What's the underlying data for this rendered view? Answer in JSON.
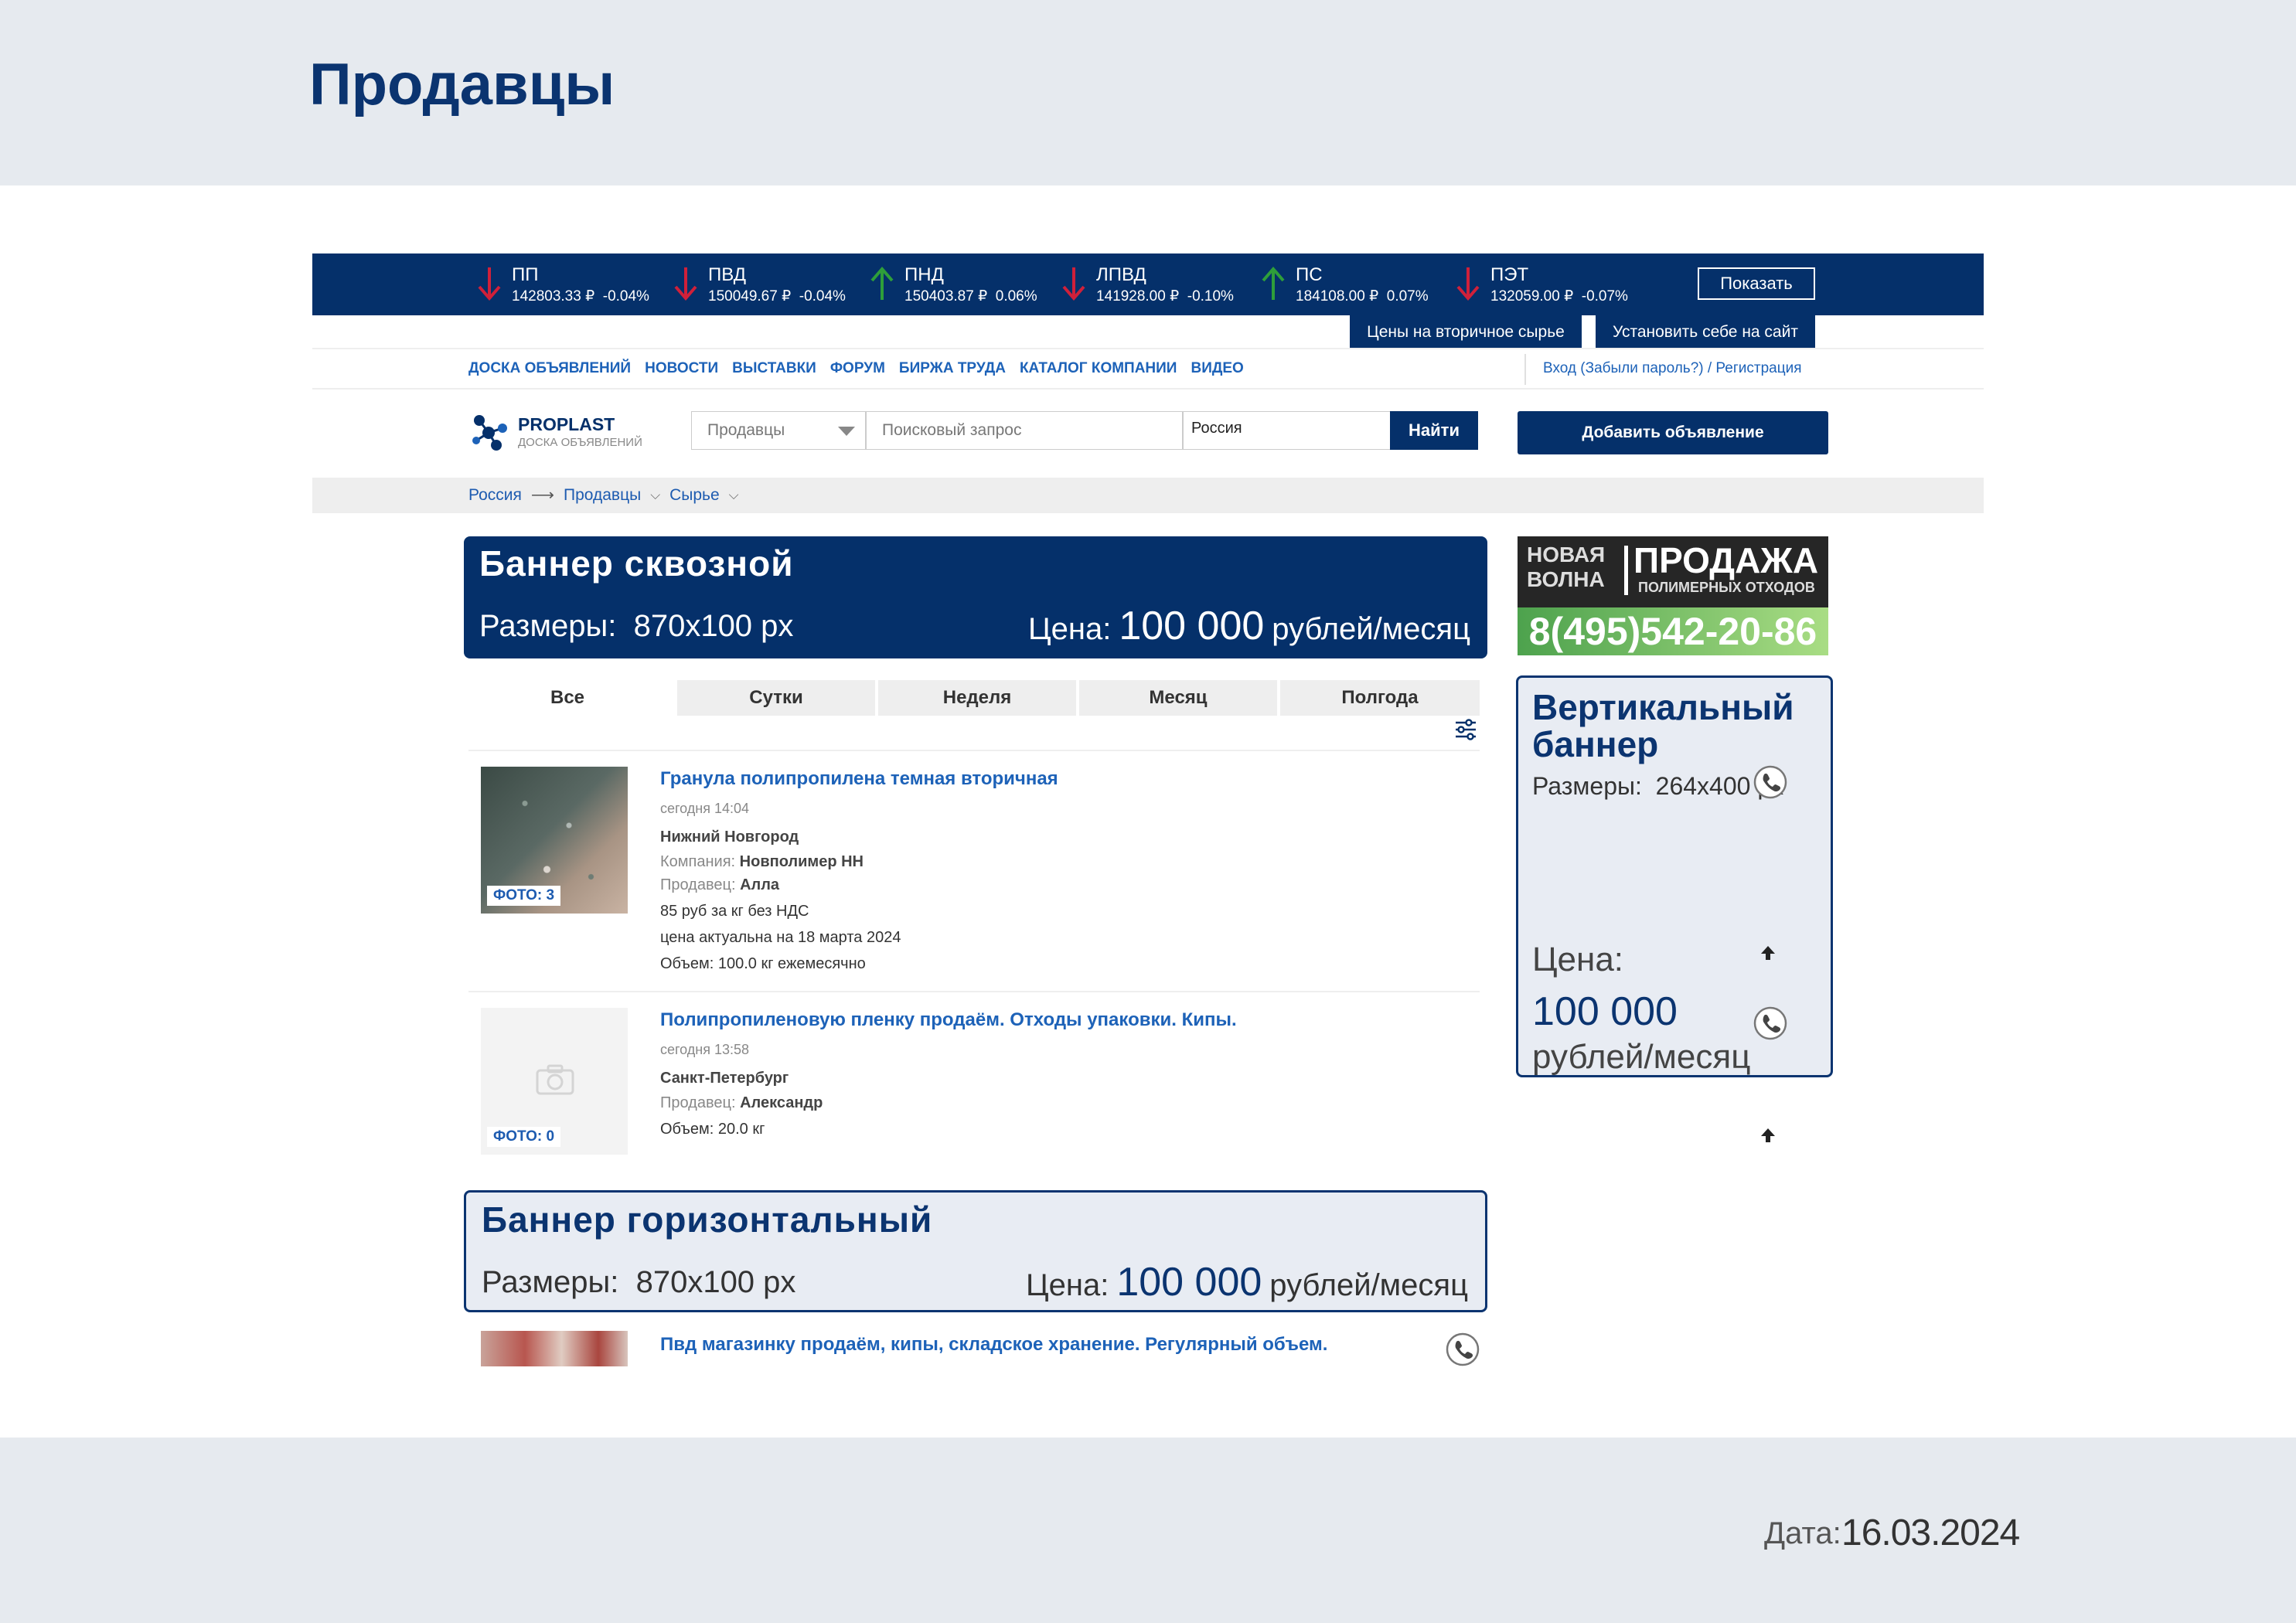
{
  "slide": {
    "title": "Продавцы",
    "date_label": "Дата:",
    "date_value": "16.03.2024"
  },
  "ticker": [
    {
      "name": "ПП",
      "price": "142803.33 ₽",
      "change": "-0.04%",
      "dir": "down"
    },
    {
      "name": "ПВД",
      "price": "150049.67 ₽",
      "change": "-0.04%",
      "dir": "down"
    },
    {
      "name": "ПНД",
      "price": "150403.87 ₽",
      "change": "0.06%",
      "dir": "up"
    },
    {
      "name": "ЛПВД",
      "price": "141928.00 ₽",
      "change": "-0.10%",
      "dir": "down"
    },
    {
      "name": "ПС",
      "price": "184108.00 ₽",
      "change": "0.07%",
      "dir": "up"
    },
    {
      "name": "ПЭТ",
      "price": "132059.00 ₽",
      "change": "-0.07%",
      "dir": "down"
    }
  ],
  "ticker_show_button": "Показать",
  "ticker_tabs": [
    "Цены на вторичное сырье",
    "Установить себе на сайт"
  ],
  "nav": {
    "items": [
      "ДОСКА ОБЪЯВЛЕНИЙ",
      "НОВОСТИ",
      "ВЫСТАВКИ",
      "ФОРУМ",
      "БИРЖА ТРУДА",
      "КАТАЛОГ КОМПАНИИ",
      "ВИДЕО"
    ],
    "login": "Вход (Забыли пароль?) / Регистрация"
  },
  "header": {
    "logo_name": "PROPLAST",
    "logo_sub": "ДОСКА ОБЪЯВЛЕНИЙ",
    "category_select": "Продавцы",
    "search_placeholder": "Поисковый запрос",
    "region": "Россия",
    "find_button": "Найти",
    "add_button": "Добавить объявление"
  },
  "breadcrumbs": [
    "Россия",
    "Продавцы",
    "Сырье"
  ],
  "banner_top": {
    "title": "Баннер сквозной",
    "size_label": "Размеры:",
    "size_value": "870x100 px",
    "price_label": "Цена:",
    "price_value": "100 000",
    "price_unit": "рублей/месяц"
  },
  "banner_bottom": {
    "title": "Баннер горизонтальный",
    "size_label": "Размеры:",
    "size_value": "870x100 px",
    "price_label": "Цена:",
    "price_value": "100 000",
    "price_unit": "рублей/месяц"
  },
  "side_ad": {
    "left_text": "НОВАЯ ВОЛНА",
    "headline": "ПРОДАЖА",
    "sub": "ПОЛИМЕРНЫХ ОТХОДОВ",
    "phone": "8(495)542-20-86"
  },
  "vertical_banner": {
    "title": "Вертикальный баннер",
    "size_label": "Размеры:",
    "size_value": "264x400 px",
    "price_label": "Цена:",
    "price_value": "100 000",
    "price_unit": "рублей/месяц"
  },
  "period_tabs": [
    "Все",
    "Сутки",
    "Неделя",
    "Месяц",
    "Полгода"
  ],
  "listings": [
    {
      "title": "Гранула полипропилена темная вторичная",
      "time": "сегодня 14:04",
      "city": "Нижний Новгород",
      "company_label": "Компания:",
      "company": "Новполимер НН",
      "seller_label": "Продавец:",
      "seller": "Алла",
      "price": "85 руб за кг без НДС",
      "actual": "цена актуальна на 18 марта 2024",
      "volume": "Объем: 100.0 кг ежемесячно",
      "photos": "ФОТО: 3"
    },
    {
      "title": "Полипропиленовую пленку продаём. Отходы упаковки. Кипы.",
      "time": "сегодня 13:58",
      "city": "Санкт-Петербург",
      "seller_label": "Продавец:",
      "seller": "Александр",
      "volume": "Объем: 20.0 кг",
      "photos": "ФОТО: 0"
    },
    {
      "title": "Пвд магазинку продаём, кипы, складское хранение. Регулярный объем."
    }
  ],
  "colors": {
    "brand_navy": "#05306a",
    "link_blue": "#1d62b8",
    "arrow_down": "#d0203a",
    "arrow_up": "#2e9e3a",
    "band_grey": "#e6eaef"
  }
}
